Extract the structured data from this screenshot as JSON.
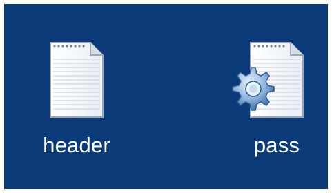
{
  "desktop": {
    "background_color": "#0b3a78",
    "items": [
      {
        "label": "header",
        "icon": "text-document-icon"
      },
      {
        "label": "pass",
        "icon": "config-document-icon"
      }
    ]
  }
}
